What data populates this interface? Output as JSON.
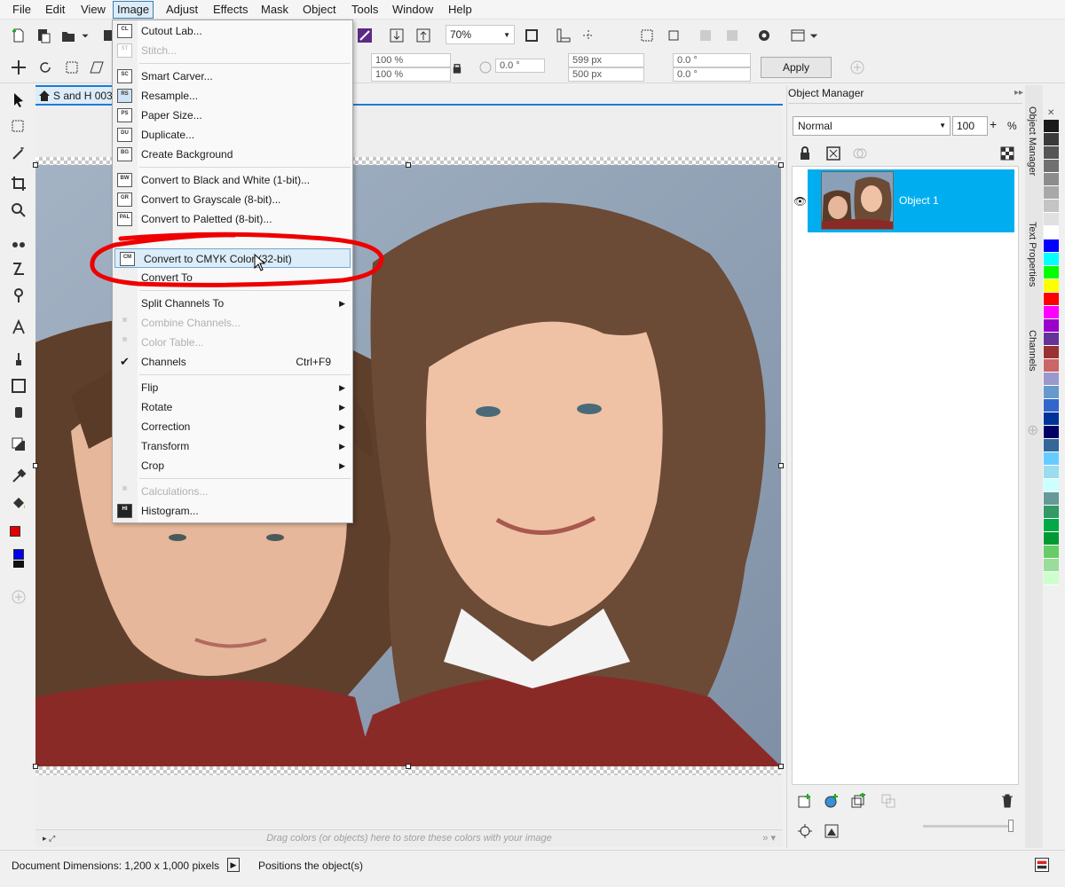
{
  "menubar": {
    "items": [
      "File",
      "Edit",
      "View",
      "Image",
      "Adjust",
      "Effects",
      "Mask",
      "Object",
      "Tools",
      "Window",
      "Help"
    ]
  },
  "toolbar": {
    "zoom": "70%",
    "scale_x": "100 %",
    "scale_y": "100 %",
    "angle": "0.0 °",
    "width": "599 px",
    "height": "500 px",
    "skew_x": "0.0 °",
    "skew_y": "0.0 °",
    "apply_label": "Apply"
  },
  "document": {
    "tab_title": "S and H 003."
  },
  "image_menu": {
    "items": [
      {
        "label": "Cutout Lab...",
        "icon": "CL"
      },
      {
        "label": "Stitch...",
        "icon": "ST",
        "disabled": true
      },
      {
        "label": "Smart Carver...",
        "icon": "SC"
      },
      {
        "label": "Resample...",
        "icon": "RS"
      },
      {
        "label": "Paper Size...",
        "icon": "PS"
      },
      {
        "label": "Duplicate...",
        "icon": "DU"
      },
      {
        "label": "Create Background",
        "icon": "BG"
      },
      {
        "label": "Convert to Black and White (1-bit)...",
        "icon": "BW"
      },
      {
        "label": "Convert to Grayscale (8-bit)...",
        "icon": "GR"
      },
      {
        "label": "Convert to Paletted (8-bit)...",
        "icon": "PAL"
      },
      {
        "label": "Convert to CMYK Color (32-bit)",
        "icon": "CM"
      },
      {
        "label": "Convert To",
        "icon": ""
      },
      {
        "label": "Split Channels To"
      },
      {
        "label": "Combine Channels...",
        "disabled": true
      },
      {
        "label": "Color Table...",
        "disabled": true
      },
      {
        "label": "Channels",
        "shortcut": "Ctrl+F9",
        "checked": true
      },
      {
        "label": "Flip"
      },
      {
        "label": "Rotate"
      },
      {
        "label": "Correction"
      },
      {
        "label": "Transform"
      },
      {
        "label": "Crop"
      },
      {
        "label": "Calculations...",
        "disabled": true
      },
      {
        "label": "Histogram...",
        "icon": "HI"
      }
    ]
  },
  "object_manager": {
    "title": "Object Manager",
    "blend_mode": "Normal",
    "opacity": "100",
    "opacity_unit": "%",
    "object_name": "Object 1"
  },
  "side_tabs": [
    "Object Manager",
    "Text Properties",
    "Channels"
  ],
  "palette_hint": "Drag colors (or objects) here to store these colors with your image",
  "status": {
    "dimensions": "Document Dimensions: 1,200 x 1,000 pixels",
    "hint": "Positions the object(s)"
  },
  "swatch_colors": [
    "#1a1a1a",
    "#3a3a3a",
    "#555555",
    "#707070",
    "#8c8c8c",
    "#a8a8a8",
    "#c4c4c4",
    "#e0e0e0",
    "#ffffff",
    "#0000ff",
    "#00ffff",
    "#00ff00",
    "#ffff00",
    "#ff0000",
    "#ff00ff",
    "#9900cc",
    "#663399",
    "#993333",
    "#cc6666",
    "#9999cc",
    "#6699cc",
    "#3366cc",
    "#003399",
    "#000066",
    "#336699",
    "#66ccff",
    "#99ddee",
    "#ccffff",
    "#669999",
    "#339966",
    "#00aa44",
    "#009933",
    "#66cc66",
    "#99dd99",
    "#ccffcc"
  ]
}
